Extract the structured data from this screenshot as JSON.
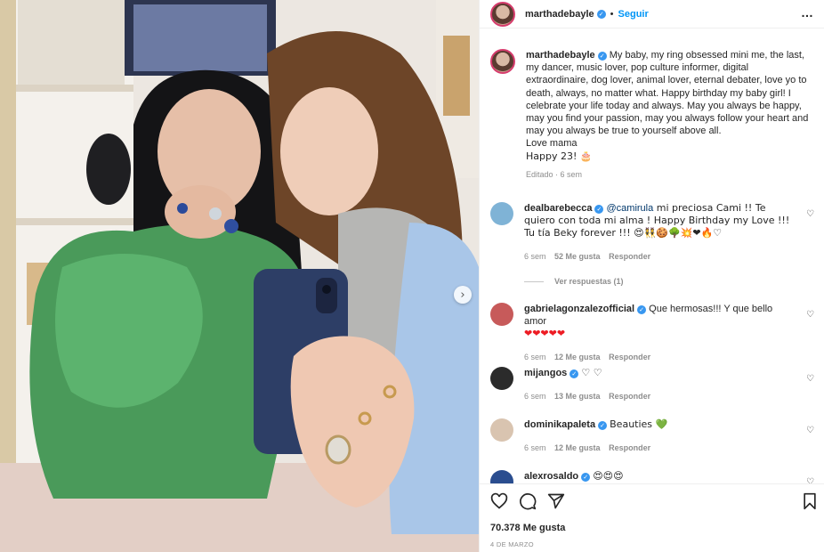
{
  "header": {
    "username": "marthadebayle",
    "dot": "•",
    "follow_label": "Seguir",
    "more_icon": "…"
  },
  "caption": {
    "username": "marthadebayle",
    "text": "My baby, my ring obsessed mini me, the last, my dancer, music lover, pop culture informer, digital extraordinaire, dog lover, animal lover, eternal debater, love yo to death, always, no matter what. Happy birthday my baby girl! I celebrate your life today and always. May you always be happy, may you find your passion, may you always follow your heart and may you always be true to yourself above all.",
    "line2": "Love mama",
    "line3": "Happy 23! 🎂",
    "meta": "Editado · 6 sem"
  },
  "comments": [
    {
      "username": "dealbarebecca",
      "mention": "@camirula",
      "text": " mi preciosa Cami !! Te quiero con toda mi alma ! Happy Birthday my Love !!! Tu tía Beky forever !!! 😍👯🍪🌳💥❤🔥♡",
      "time": "6 sem",
      "likes": "52 Me gusta",
      "reply": "Responder",
      "avatar_color": "#7fb3d6"
    },
    {
      "username": "gabrielagonzalezofficial",
      "text": "Que hermosas!!! Y que bello amor",
      "hearts": "❤❤❤❤❤",
      "time": "6 sem",
      "likes": "12 Me gusta",
      "reply": "Responder",
      "avatar_color": "#c75a5a"
    },
    {
      "username": "mijangos",
      "text": "♡ ♡",
      "time": "6 sem",
      "likes": "13 Me gusta",
      "reply": "Responder",
      "avatar_color": "#2b2b2b"
    },
    {
      "username": "dominikapaleta",
      "text": "Beauties 💚",
      "time": "6 sem",
      "likes": "12 Me gusta",
      "reply": "Responder",
      "avatar_color": "#d9c4b0"
    },
    {
      "username": "alexrosaldo",
      "text": "😍😍😍",
      "avatar_color": "#2a4d8f"
    }
  ],
  "replies_label": "Ver respuestas (1)",
  "footer": {
    "likes": "70.378 Me gusta",
    "date": "4 DE MARZO"
  },
  "photo": {
    "next_icon": "›"
  },
  "colors": {
    "accent": "#0095f6",
    "verified": "#3897f0",
    "muted": "#8e8e8e",
    "text": "#262626"
  }
}
